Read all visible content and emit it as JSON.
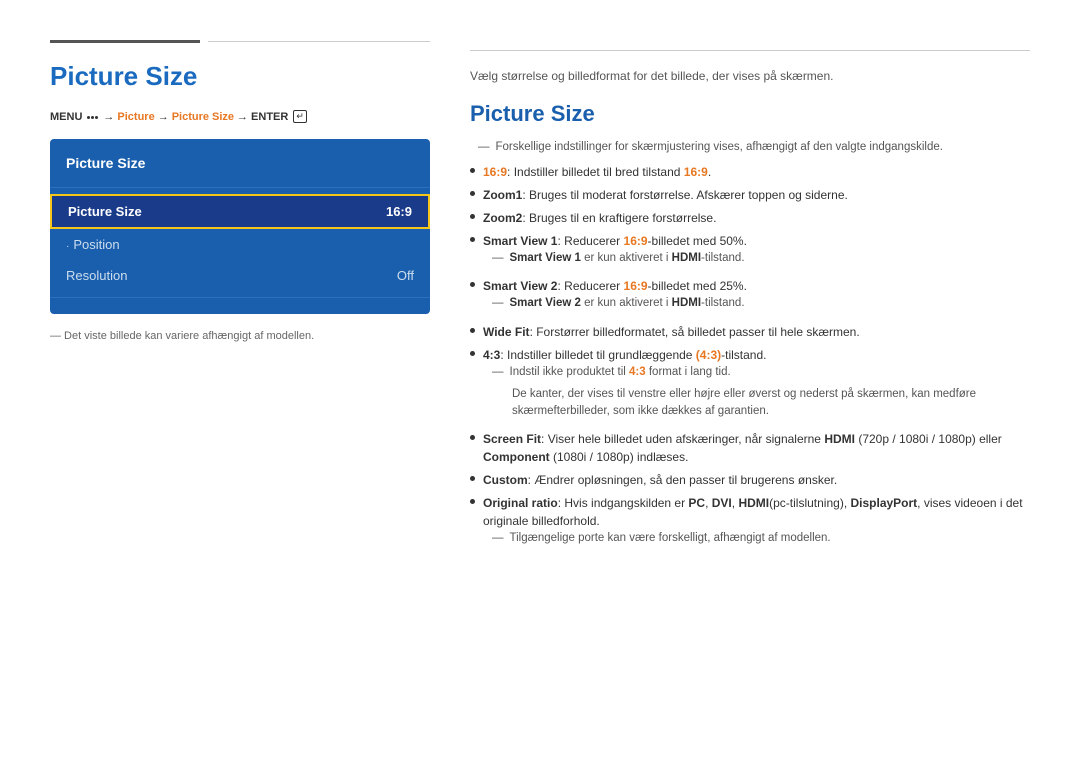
{
  "left": {
    "top_line_exists": true,
    "page_title": "Picture Size",
    "menu_path": {
      "menu_label": "MENU",
      "arrow1": "→",
      "picture": "Picture",
      "arrow2": "→",
      "picture_size": "Picture Size",
      "arrow3": "→",
      "enter": "ENTER"
    },
    "menu_box": {
      "title": "Picture Size",
      "items": [
        {
          "label": "Picture Size",
          "value": "16:9",
          "selected": true,
          "dot": false
        },
        {
          "label": "Position",
          "value": "",
          "selected": false,
          "dot": true
        },
        {
          "label": "Resolution",
          "value": "Off",
          "selected": false,
          "dot": false
        }
      ]
    },
    "note": "— Det viste billede kan variere afhængigt af modellen."
  },
  "right": {
    "intro": "Vælg størrelse og billedformat for det billede, der vises på skærmen.",
    "title": "Picture Size",
    "section_note": "Forskellige indstillinger for skærmjustering vises, afhængigt af den valgte indgangskilde.",
    "bullets": [
      {
        "id": 1,
        "parts": [
          {
            "text": "16:9",
            "style": "bold-orange"
          },
          {
            "text": ": Indstiller billedet til bred tilstand ",
            "style": "normal"
          },
          {
            "text": "16:9",
            "style": "bold-orange"
          },
          {
            "text": ".",
            "style": "normal"
          }
        ],
        "subnotes": []
      },
      {
        "id": 2,
        "parts": [
          {
            "text": "Zoom1",
            "style": "bold-black"
          },
          {
            "text": ": Bruges til moderat forstørrelse. Afskærer toppen og siderne.",
            "style": "normal"
          }
        ],
        "subnotes": []
      },
      {
        "id": 3,
        "parts": [
          {
            "text": "Zoom2",
            "style": "bold-black"
          },
          {
            "text": ": Bruges til en kraftigere forstørrelse.",
            "style": "normal"
          }
        ],
        "subnotes": []
      },
      {
        "id": 4,
        "parts": [
          {
            "text": "Smart View 1",
            "style": "bold-black"
          },
          {
            "text": ": Reducerer ",
            "style": "normal"
          },
          {
            "text": "16:9",
            "style": "bold-orange"
          },
          {
            "text": "-billedet med 50%.",
            "style": "normal"
          }
        ],
        "subnotes": [
          {
            "text": "Smart View 1",
            "style": "bold-black",
            "rest": " er kun aktiveret i ",
            "highlight": "HDMI",
            "highlight_style": "bold-black",
            "end": "-tilstand."
          }
        ]
      },
      {
        "id": 5,
        "parts": [
          {
            "text": "Smart View 2",
            "style": "bold-black"
          },
          {
            "text": ": Reducerer ",
            "style": "normal"
          },
          {
            "text": "16:9",
            "style": "bold-orange"
          },
          {
            "text": "-billedet med 25%.",
            "style": "normal"
          }
        ],
        "subnotes": [
          {
            "text": "Smart View 2",
            "style": "bold-black",
            "rest": " er kun aktiveret i ",
            "highlight": "HDMI",
            "highlight_style": "bold-black",
            "end": "-tilstand."
          }
        ]
      },
      {
        "id": 6,
        "parts": [
          {
            "text": "Wide Fit",
            "style": "bold-black"
          },
          {
            "text": ": Forstørrer billedformatet, så billedet passer til hele skærmen.",
            "style": "normal"
          }
        ],
        "subnotes": []
      },
      {
        "id": 7,
        "parts": [
          {
            "text": "4:3",
            "style": "bold-black"
          },
          {
            "text": ": Indstiller billedet til grundlæggende ",
            "style": "normal"
          },
          {
            "text": "(4:3)",
            "style": "bold-orange"
          },
          {
            "text": "-tilstand.",
            "style": "normal"
          }
        ],
        "subnotes": [
          {
            "raw": "— Indstil ikke produktet til ",
            "highlight1": "4:3",
            "h1style": "bold-orange",
            "rest": " format i lang tid."
          },
          {
            "raw_indent": "De kanter, der vises til venstre eller højre eller øverst og nederst på skærmen, kan medføre skærmefterbilleder, som ikke dækkes af garantien."
          }
        ]
      },
      {
        "id": 8,
        "parts": [
          {
            "text": "Screen Fit",
            "style": "bold-black"
          },
          {
            "text": ": Viser hele billedet uden afskæringer, når signalerne ",
            "style": "normal"
          },
          {
            "text": "HDMI",
            "style": "bold-black"
          },
          {
            "text": " (720p / 1080i / 1080p) eller ",
            "style": "normal"
          },
          {
            "text": "Component",
            "style": "bold-black"
          },
          {
            "text": " (1080i / 1080p) indlæses.",
            "style": "normal"
          }
        ],
        "subnotes": []
      },
      {
        "id": 9,
        "parts": [
          {
            "text": "Custom",
            "style": "bold-black"
          },
          {
            "text": ": Ændrer opløsningen, så den passer til brugerens ønsker.",
            "style": "normal"
          }
        ],
        "subnotes": []
      },
      {
        "id": 10,
        "parts": [
          {
            "text": "Original ratio",
            "style": "bold-black"
          },
          {
            "text": ": Hvis indgangskilden er ",
            "style": "normal"
          },
          {
            "text": "PC",
            "style": "bold-black"
          },
          {
            "text": ", ",
            "style": "normal"
          },
          {
            "text": "DVI",
            "style": "bold-black"
          },
          {
            "text": ", ",
            "style": "normal"
          },
          {
            "text": "HDMI",
            "style": "bold-black"
          },
          {
            "text": "(pc-tilslutning), ",
            "style": "normal"
          },
          {
            "text": "DisplayPort",
            "style": "bold-black"
          },
          {
            "text": ", vises videoen i det originale billedforhold.",
            "style": "normal"
          }
        ],
        "subnotes": [
          {
            "raw_dash": "Tilgængelige porte kan være forskelligt, afhængigt af modellen."
          }
        ]
      }
    ]
  }
}
